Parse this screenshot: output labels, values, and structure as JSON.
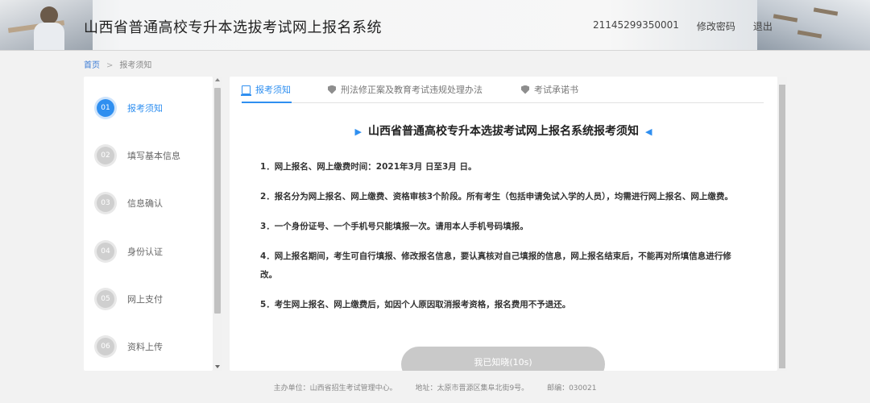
{
  "header": {
    "title": "山西省普通高校专升本选拔考试网上报名系统",
    "user_id": "21145299350001",
    "change_password": "修改密码",
    "logout": "退出"
  },
  "breadcrumb": {
    "home": "首页",
    "separator": ">",
    "current": "报考须知"
  },
  "steps": [
    {
      "num": "01",
      "label": "报考须知",
      "active": true
    },
    {
      "num": "02",
      "label": "填写基本信息",
      "active": false
    },
    {
      "num": "03",
      "label": "信息确认",
      "active": false
    },
    {
      "num": "04",
      "label": "身份认证",
      "active": false
    },
    {
      "num": "05",
      "label": "网上支付",
      "active": false
    },
    {
      "num": "06",
      "label": "资料上传",
      "active": false
    }
  ],
  "tabs": [
    {
      "label": "报考须知",
      "icon": "book-icon",
      "active": true
    },
    {
      "label": "刑法修正案及教育考试违规处理办法",
      "icon": "shield-icon",
      "active": false
    },
    {
      "label": "考试承诺书",
      "icon": "shield-icon",
      "active": false
    }
  ],
  "notice": {
    "title": "山西省普通高校专升本选拔考试网上报名系统报考须知",
    "items": [
      "1．网上报名、网上缴费时间：2021年3月 日至3月 日。",
      "2．报名分为网上报名、网上缴费、资格审核3个阶段。所有考生（包括申请免试入学的人员），均需进行网上报名、网上缴费。",
      "3．一个身份证号、一个手机号只能填报一次。请用本人手机号码填报。",
      "4．网上报名期间，考生可自行填报、修改报名信息，要认真核对自己填报的信息，网上报名结束后，不能再对所填信息进行修改。",
      "5．考生网上报名、网上缴费后，如因个人原因取消报考资格，报名费用不予退还。"
    ],
    "ack_button": "我已知晓(10s)"
  },
  "footer": {
    "host": "主办单位：山西省招生考试管理中心。",
    "address": "地址：太原市晋源区集阜北街9号。",
    "postcode": "邮编：030021"
  },
  "colors": {
    "accent": "#2f8ff0",
    "disabled_button": "#c9c9c9"
  }
}
